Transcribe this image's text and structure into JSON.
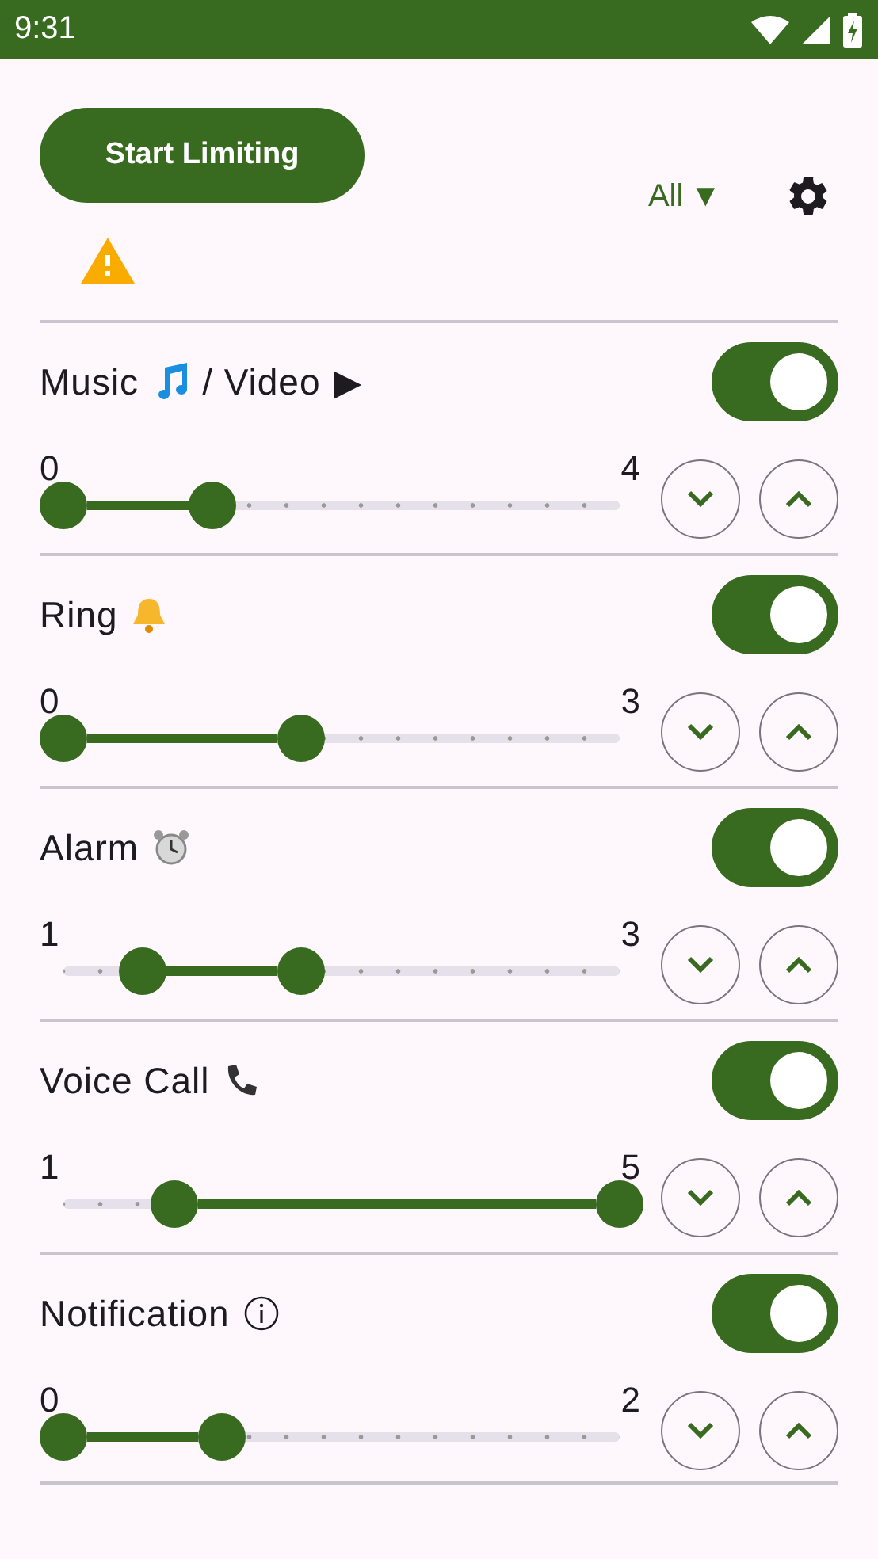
{
  "status_bar": {
    "time": "9:31"
  },
  "start_button": {
    "label": "Start Limiting"
  },
  "filter": {
    "label": "All",
    "arrow": "▼"
  },
  "channels": [
    {
      "name": "Music",
      "extra": "/ Video",
      "extra_glyph": "▶",
      "on": true,
      "min_label": "0",
      "max_label": "4",
      "thumbs": [
        {
          "level": 0
        },
        {
          "level": 0.2667
        }
      ]
    },
    {
      "name": "Ring",
      "on": true,
      "min_label": "0",
      "max_label": "3",
      "thumbs": [
        {
          "level": 0
        },
        {
          "level": 0.4286
        }
      ]
    },
    {
      "name": "Alarm",
      "on": true,
      "min_label": "1",
      "max_label": "3",
      "thumbs": [
        {
          "level": 0.1429
        },
        {
          "level": 0.4286
        }
      ]
    },
    {
      "name": "Voice Call",
      "on": true,
      "min_label": "1",
      "max_label": "5",
      "thumbs": [
        {
          "level": 0.2
        },
        {
          "level": 1
        }
      ]
    },
    {
      "name": "Notification",
      "on": true,
      "min_label": "0",
      "max_label": "2",
      "thumbs": [
        {
          "level": 0
        },
        {
          "level": 0.2857
        }
      ]
    }
  ]
}
